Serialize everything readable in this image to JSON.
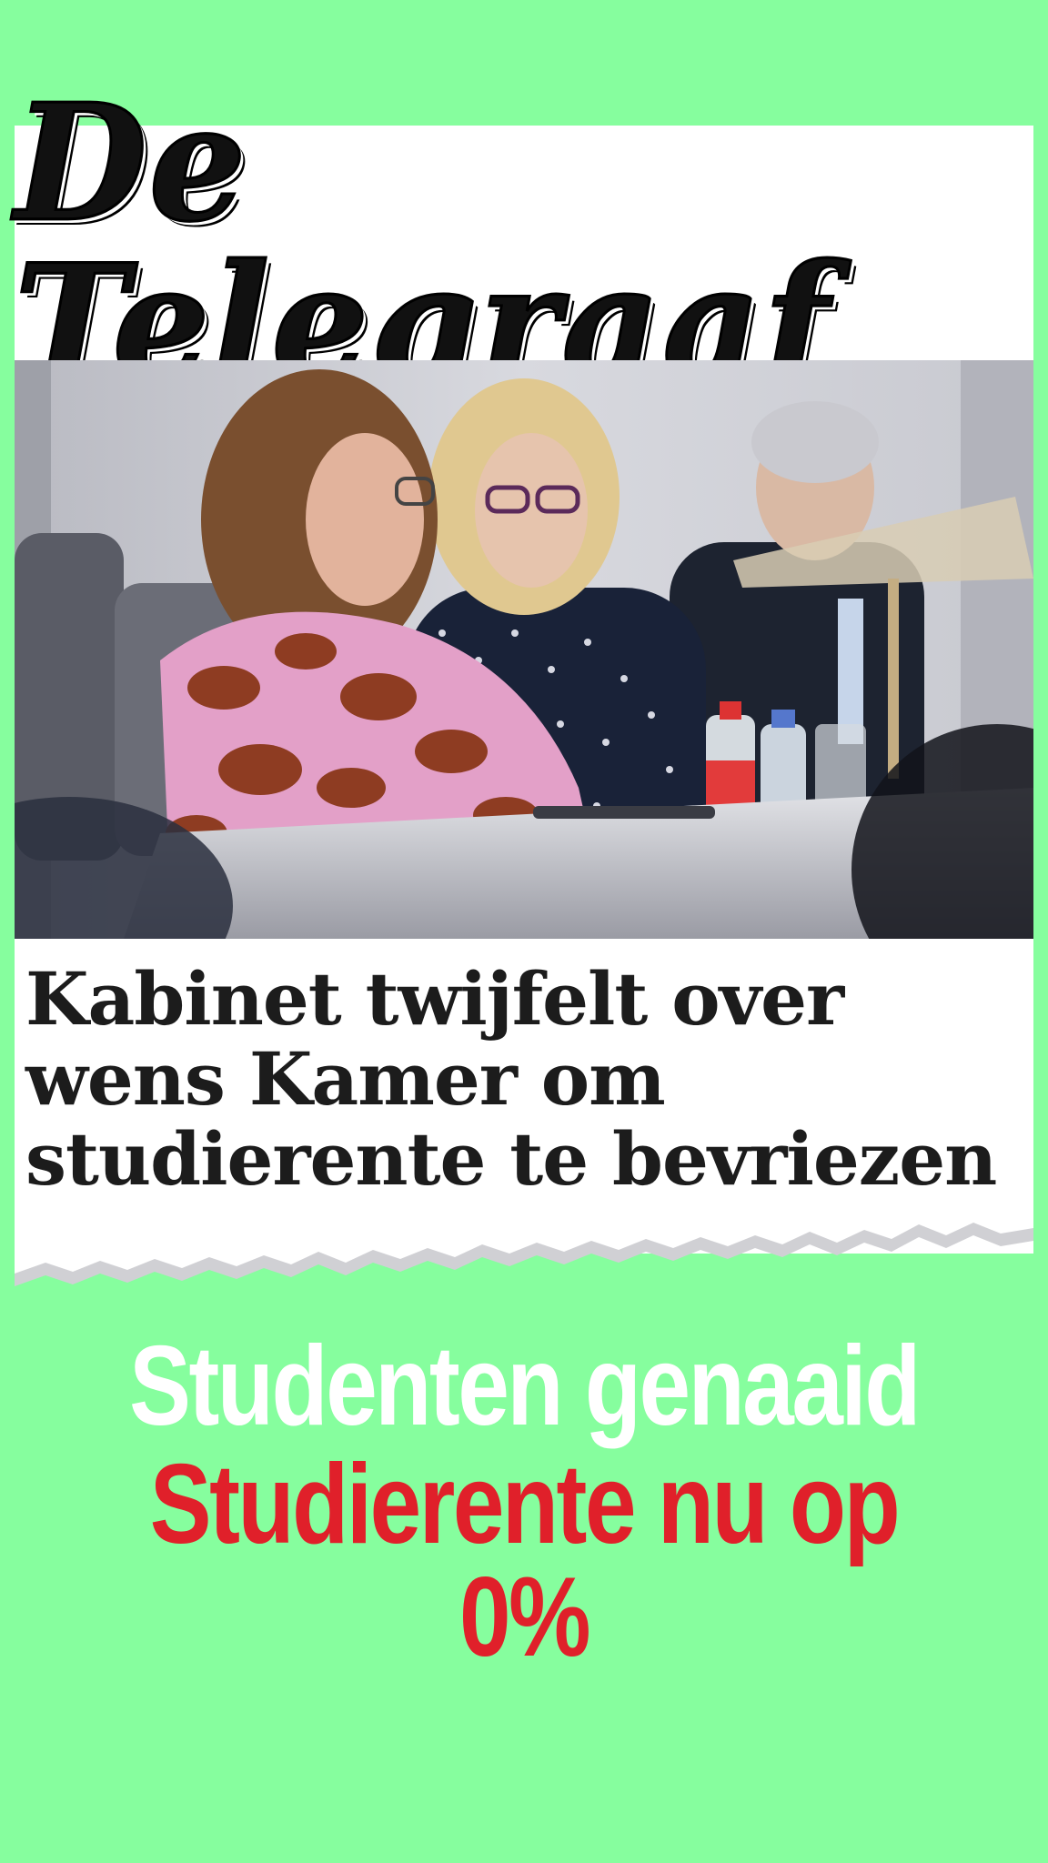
{
  "masthead": {
    "logo_text": "De Telegraaf"
  },
  "article": {
    "photo_alt": "Kabinet twijfelt over wens Kamer om studierente te bevriezen",
    "headline": "Kabinet twijfelt over wens Kamer om studierente te bevriezen"
  },
  "slogan": {
    "line1": "Studenten genaaid",
    "line2": "Studierente nu op 0%"
  },
  "colors": {
    "background": "#86fe9e",
    "slogan_line1": "#ffffff",
    "slogan_line2": "#e0202a",
    "headline": "#1c1c1c"
  }
}
